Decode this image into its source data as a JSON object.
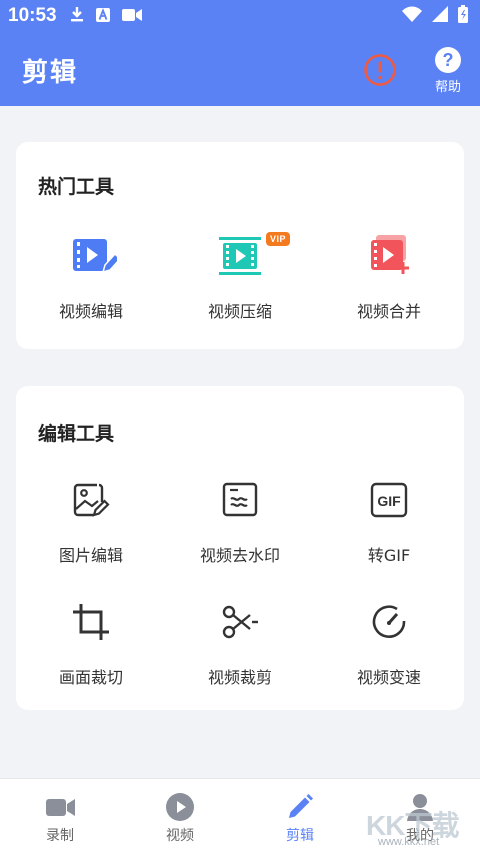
{
  "status_bar": {
    "time": "10:53",
    "icons_left": [
      "download-icon",
      "text-a-icon",
      "video-camera-icon"
    ],
    "icons_right": [
      "wifi-icon",
      "signal-icon",
      "battery-icon"
    ]
  },
  "header": {
    "title": "剪辑",
    "alert_icon": "alert-circle-icon",
    "help_label": "帮助",
    "help_glyph": "?"
  },
  "hot_tools": {
    "title": "热门工具",
    "items": [
      {
        "label": "视频编辑",
        "icon": "video-edit-icon"
      },
      {
        "label": "视频压缩",
        "icon": "video-compress-icon",
        "badge": "VIP"
      },
      {
        "label": "视频合并",
        "icon": "video-merge-icon"
      }
    ]
  },
  "edit_tools": {
    "title": "编辑工具",
    "items": [
      {
        "label": "图片编辑",
        "icon": "image-edit-icon"
      },
      {
        "label": "视频去水印",
        "icon": "remove-watermark-icon"
      },
      {
        "label": "转GIF",
        "icon": "gif-icon",
        "glyph": "GIF"
      },
      {
        "label": "画面裁切",
        "icon": "crop-icon"
      },
      {
        "label": "视频裁剪",
        "icon": "scissors-icon"
      },
      {
        "label": "视频变速",
        "icon": "speed-icon"
      }
    ]
  },
  "tabbar": {
    "items": [
      {
        "label": "录制",
        "icon": "record-icon",
        "active": false
      },
      {
        "label": "视频",
        "icon": "play-icon",
        "active": false
      },
      {
        "label": "剪辑",
        "icon": "pencil-icon",
        "active": true
      },
      {
        "label": "我的",
        "icon": "profile-icon",
        "active": false
      }
    ]
  },
  "watermark": {
    "text": "KK下载",
    "url": "www.kkx.net"
  },
  "colors": {
    "primary": "#5b82f5",
    "alert": "#f05a40",
    "vip": "#f47a20",
    "blue_icon": "#4d7cf4",
    "teal_icon": "#1fc8b4",
    "red_icon": "#f2545b"
  }
}
